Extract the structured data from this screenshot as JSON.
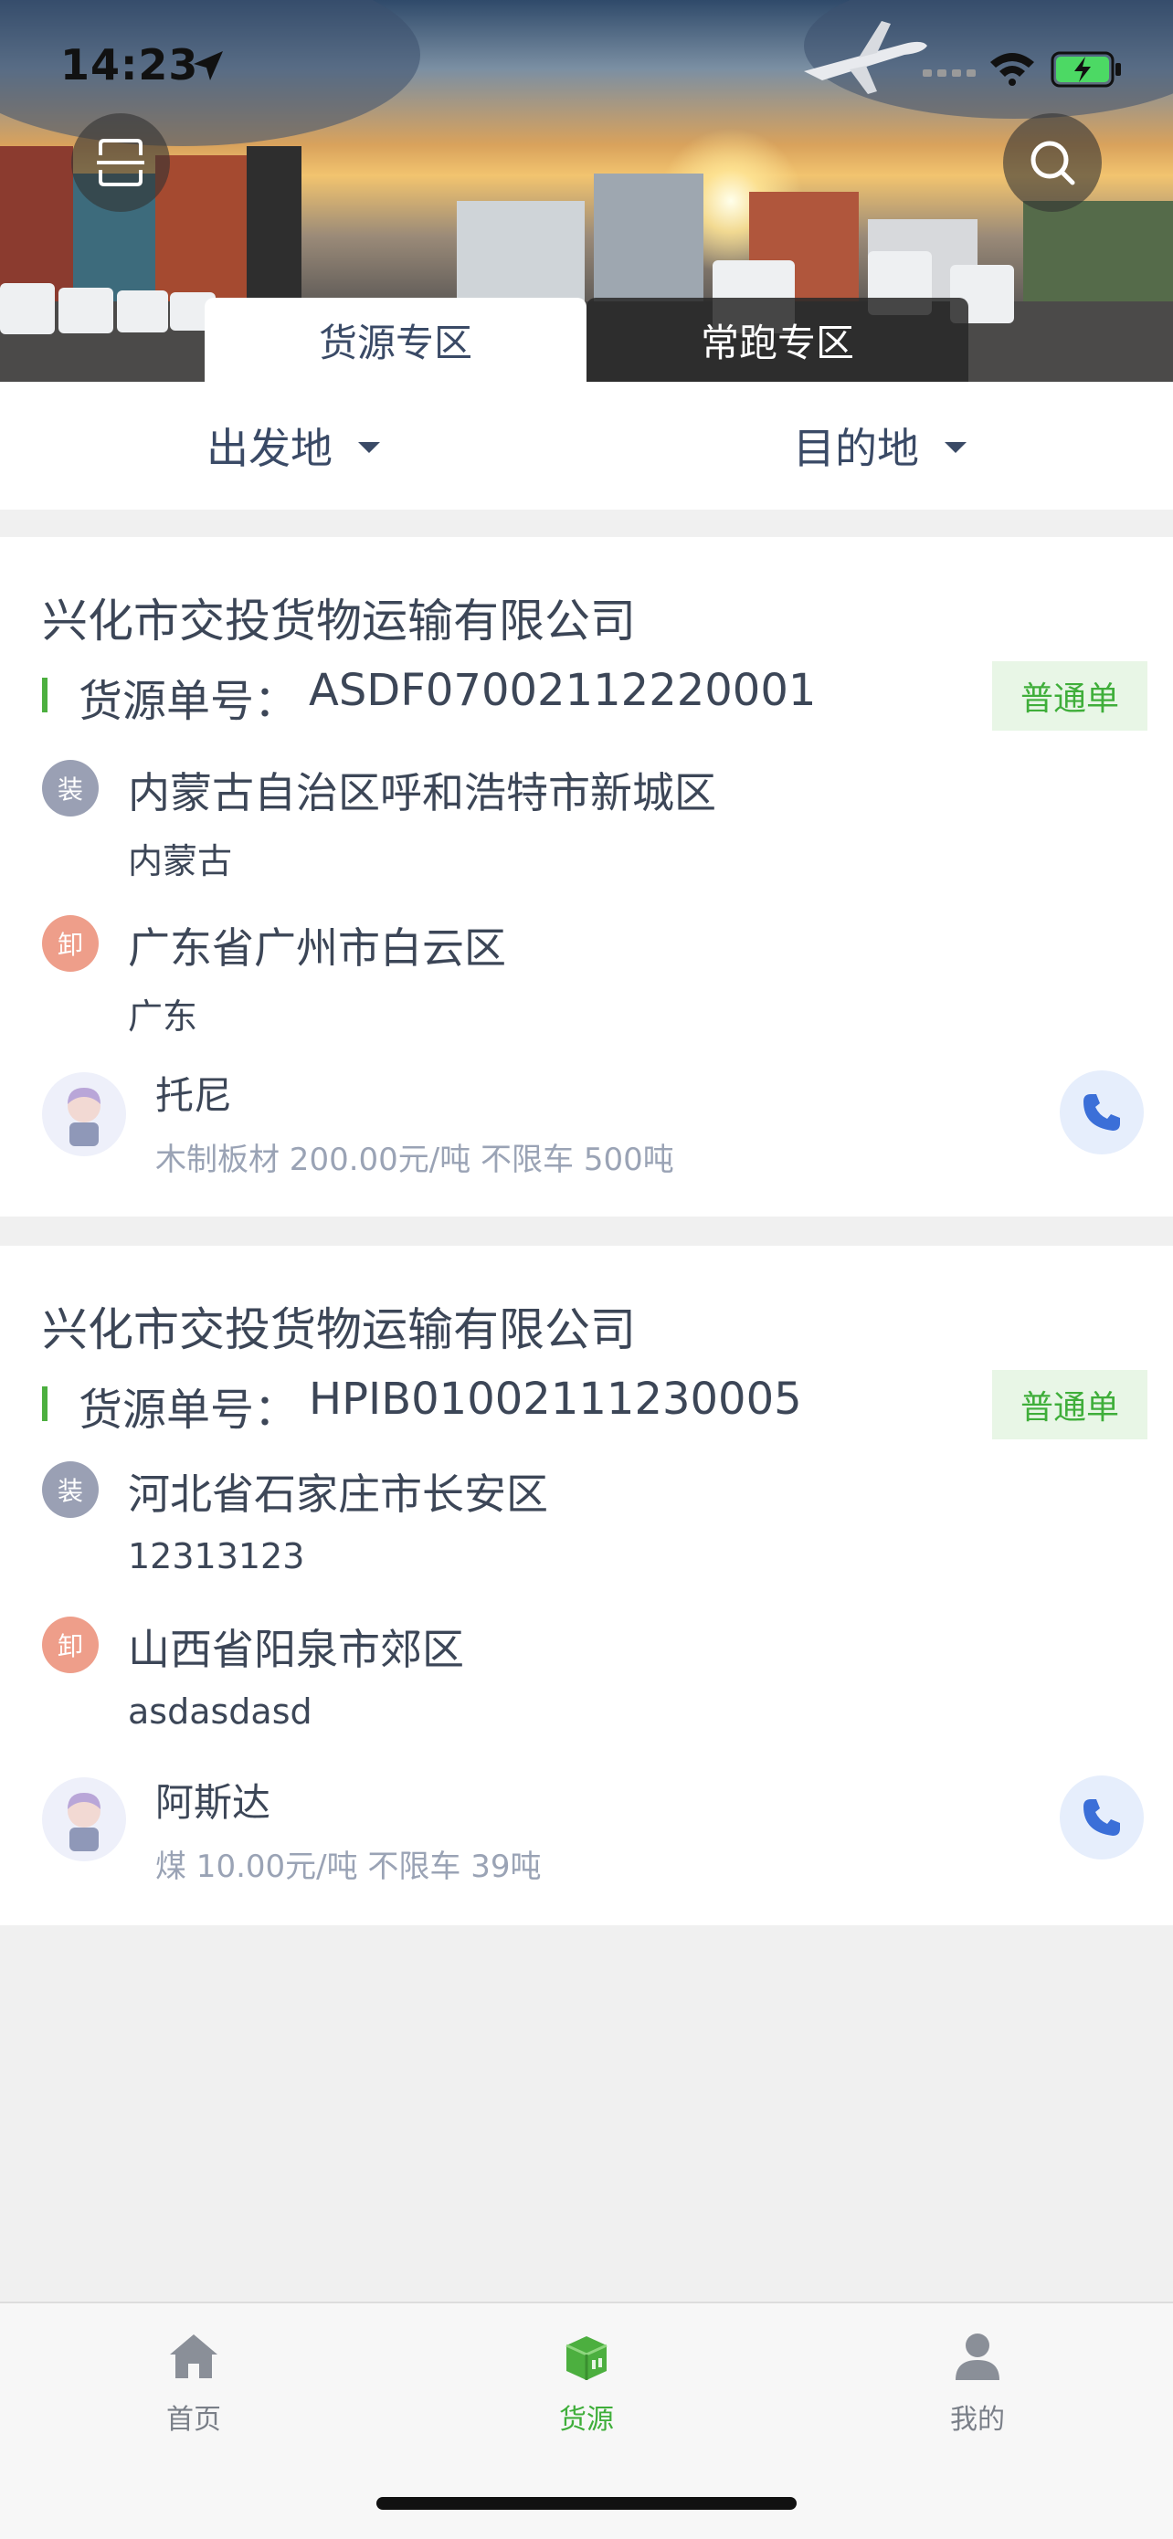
{
  "status_bar": {
    "time": "14:23"
  },
  "header": {
    "tabs": [
      {
        "label": "货源专区",
        "active": true
      },
      {
        "label": "常跑专区",
        "active": false
      }
    ]
  },
  "filters": {
    "origin": "出发地",
    "destination": "目的地"
  },
  "cards": [
    {
      "company": "兴化市交投货物运输有限公司",
      "order_label": "货源单号：",
      "order_no": "ASDF07002112220001",
      "badge": "普通单",
      "load_tag": "装",
      "load_address": "内蒙古自治区呼和浩特市新城区",
      "load_sub": "内蒙古",
      "unload_tag": "卸",
      "unload_address": "广东省广州市白云区",
      "unload_sub": "广东",
      "contact_name": "托尼",
      "detail": "木制板材 200.00元/吨 不限车 500吨"
    },
    {
      "company": "兴化市交投货物运输有限公司",
      "order_label": "货源单号：",
      "order_no": "HPIB01002111230005",
      "badge": "普通单",
      "load_tag": "装",
      "load_address": "河北省石家庄市长安区",
      "load_sub": "12313123",
      "unload_tag": "卸",
      "unload_address": "山西省阳泉市郊区",
      "unload_sub": "asdasdasd",
      "contact_name": "阿斯达",
      "detail": "煤 10.00元/吨 不限车 39吨"
    }
  ],
  "bottom_nav": [
    {
      "label": "首页",
      "icon": "home-icon",
      "active": false
    },
    {
      "label": "货源",
      "icon": "cargo-box-icon",
      "active": true
    },
    {
      "label": "我的",
      "icon": "user-icon",
      "active": false
    }
  ],
  "colors": {
    "accent_green": "#3fae3a",
    "text_dark": "#3c4657",
    "phone_blue": "#3b6fd8"
  }
}
